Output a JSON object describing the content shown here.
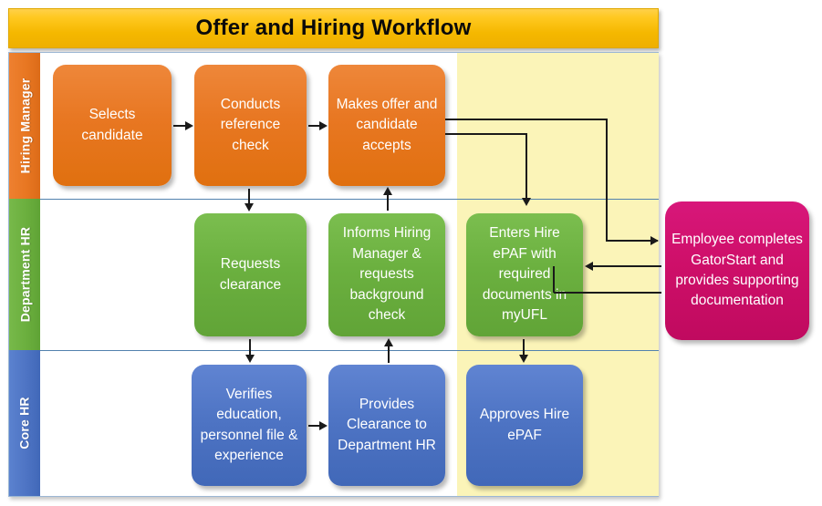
{
  "title": {
    "text": "Offer and Hiring Workflow"
  },
  "colors": {
    "title_bar": "#F5B800",
    "hiring_manager": "#E87722",
    "department_hr": "#6BB03F",
    "core_hr": "#4E74C4",
    "employee": "#CE0F69",
    "highlight_column": "#FBF4B8",
    "lane_divider": "#5282AE",
    "connector": "#1a1a1a"
  },
  "lanes": [
    {
      "id": "hiring-manager",
      "label": "Hiring Manager",
      "color": "#E87722"
    },
    {
      "id": "department-hr",
      "label": "Department HR",
      "color": "#6BB03F"
    },
    {
      "id": "core-hr",
      "label": "Core HR",
      "color": "#4E74C4"
    }
  ],
  "nodes": {
    "hm1": "Selects candidate",
    "hm2": "Conducts reference check",
    "hm3": "Makes offer and candidate accepts",
    "dhr1": "Requests clearance",
    "dhr2": "Informs Hiring Manager & requests background check",
    "dhr3": "Enters Hire ePAF with required documents in myUFL",
    "chr1": "Verifies education, personnel file & experience",
    "chr2": "Provides Clearance to Department HR",
    "chr3": "Approves Hire ePAF",
    "employee": "Employee completes GatorStart and provides supporting documentation"
  },
  "connectors": [
    {
      "name": "hm1-to-hm2",
      "from": "Selects candidate",
      "to": "Conducts reference check",
      "direction": "right"
    },
    {
      "name": "hm2-to-hm3",
      "from": "Conducts reference check",
      "to": "Makes offer and candidate accepts",
      "direction": "right"
    },
    {
      "name": "hm2-to-dhr1",
      "from": "Conducts reference check",
      "to": "Requests clearance",
      "direction": "down"
    },
    {
      "name": "dhr2-to-hm3",
      "from": "Informs Hiring Manager & requests background check",
      "to": "Makes offer and candidate accepts",
      "direction": "up"
    },
    {
      "name": "dhr1-to-chr1",
      "from": "Requests clearance",
      "to": "Verifies education, personnel file & experience",
      "direction": "down"
    },
    {
      "name": "chr2-to-dhr2",
      "from": "Provides Clearance to Department HR",
      "to": "Informs Hiring Manager & requests background check",
      "direction": "up"
    },
    {
      "name": "chr1-to-chr2",
      "from": "Verifies education, personnel file & experience",
      "to": "Provides Clearance to Department HR",
      "direction": "right"
    },
    {
      "name": "hm3-to-employee",
      "from": "Makes offer and candidate accepts",
      "to": "Employee completes GatorStart and provides supporting documentation",
      "direction": "right"
    },
    {
      "name": "hm3-to-dhr3",
      "from": "Makes offer and candidate accepts",
      "to": "Enters Hire ePAF with required documents in myUFL",
      "direction": "down"
    },
    {
      "name": "employee-to-dhr3",
      "from": "Employee completes GatorStart and provides supporting documentation",
      "to": "Enters Hire ePAF with required documents in myUFL",
      "direction": "left"
    },
    {
      "name": "dhr3-to-chr3",
      "from": "Enters Hire ePAF with required documents in myUFL",
      "to": "Approves Hire ePAF",
      "direction": "down"
    }
  ]
}
